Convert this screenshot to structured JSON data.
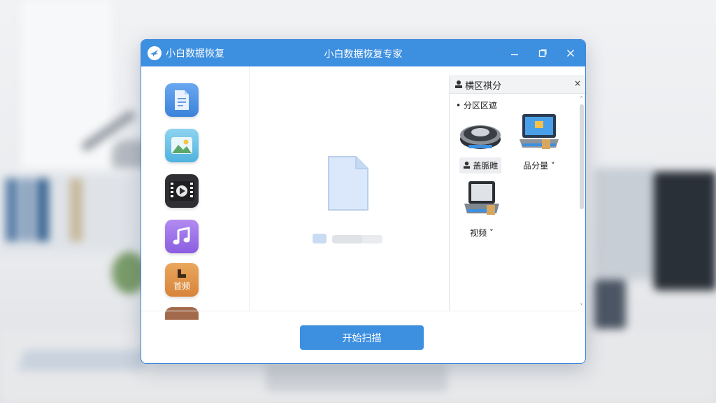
{
  "app": {
    "name": "小白数据恢复",
    "window_title": "小白数据恢复专家",
    "controls": {
      "minimize": "—",
      "maximize": "◻",
      "close": "✕"
    }
  },
  "categories": [
    {
      "name": "document",
      "icon": "document-icon"
    },
    {
      "name": "image",
      "icon": "image-icon"
    },
    {
      "name": "video",
      "icon": "video-icon"
    },
    {
      "name": "music",
      "icon": "music-icon"
    },
    {
      "name": "other",
      "icon": "other-icon",
      "label": "首频"
    }
  ],
  "center": {
    "progress": 0.6
  },
  "right_panel": {
    "title": "横区祺分",
    "close": "×",
    "subtitle": "• 分区区遮",
    "drives": [
      {
        "caption": "盖脈睢",
        "icon": "disk-icon",
        "selected": true
      },
      {
        "caption": "品分量 ˅",
        "icon": "laptop-drive-icon",
        "selected": false
      },
      {
        "caption": "视频 ˅",
        "icon": "external-drive-icon",
        "selected": false
      }
    ],
    "scroll_up": "˄",
    "scroll_down": "˅"
  },
  "footer": {
    "scan_button": "开始扫描"
  },
  "colors": {
    "accent": "#3d8fe0"
  }
}
